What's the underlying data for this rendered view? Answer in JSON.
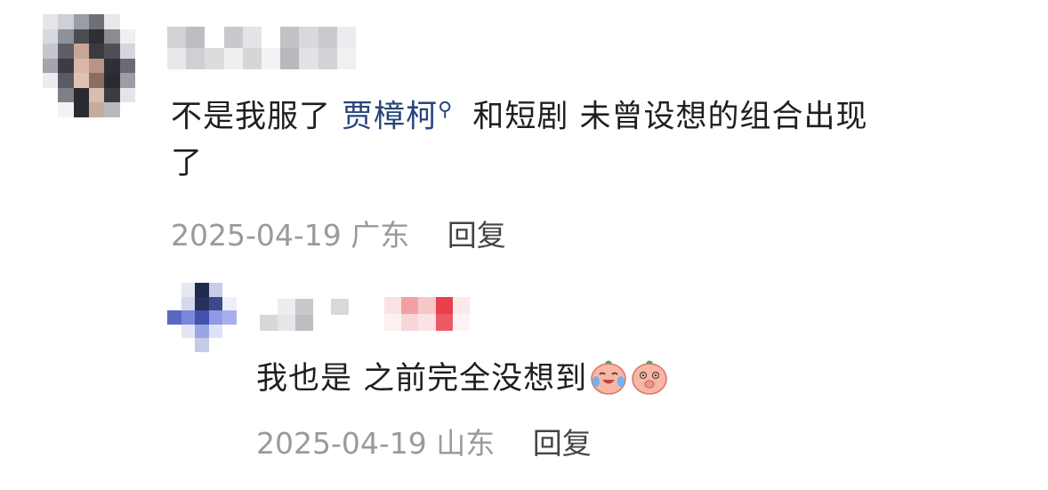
{
  "comments": [
    {
      "text_before": "不是我服了 ",
      "mention": "贾樟柯",
      "text_after": " 和短剧 未曾设想的组合出现",
      "text_line2": "了",
      "date": "2025-04-19",
      "location": "广东",
      "reply_label": "回复"
    }
  ],
  "replies": [
    {
      "text": "我也是 之前完全没想到",
      "emojis": [
        "crying-laughing-peach-emoji",
        "shy-peach-emoji"
      ],
      "date": "2025-04-19",
      "location": "山东",
      "reply_label": "回复"
    }
  ],
  "icons": {
    "mention_search": "search-icon"
  },
  "colors": {
    "mention": "#26457a",
    "meta": "#9a9a9a",
    "text": "#1f1f1f"
  }
}
